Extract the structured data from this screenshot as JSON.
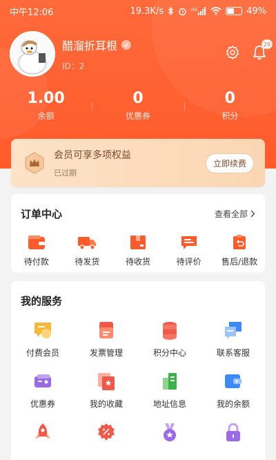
{
  "status_bar": {
    "time": "中午12:06",
    "network_speed": "19.3K/s",
    "battery": "49%",
    "battery_level": 0.49
  },
  "profile": {
    "username": "醋溜折耳根",
    "user_id": "ID：2",
    "notification_count": "29"
  },
  "stats": [
    {
      "value": "1.00",
      "label": "余额"
    },
    {
      "value": "0",
      "label": "优惠券"
    },
    {
      "value": "0",
      "label": "积分"
    }
  ],
  "membership": {
    "title": "会员可享多项权益",
    "status": "已过期",
    "renew_label": "立即续费"
  },
  "orders": {
    "title": "订单中心",
    "see_all": "查看全部",
    "items": [
      {
        "label": "待付款",
        "icon": "wallet-icon"
      },
      {
        "label": "待发货",
        "icon": "truck-icon"
      },
      {
        "label": "待收货",
        "icon": "package-icon"
      },
      {
        "label": "待评价",
        "icon": "comment-icon"
      },
      {
        "label": "售后/退款",
        "icon": "refund-icon"
      }
    ]
  },
  "services": {
    "title": "我的服务",
    "items": [
      {
        "label": "付费会员",
        "icon": "vip-icon"
      },
      {
        "label": "发票管理",
        "icon": "invoice-icon"
      },
      {
        "label": "积分中心",
        "icon": "points-icon"
      },
      {
        "label": "联系客服",
        "icon": "chat-icon"
      },
      {
        "label": "优惠券",
        "icon": "coupon-icon"
      },
      {
        "label": "我的收藏",
        "icon": "favorite-icon"
      },
      {
        "label": "地址信息",
        "icon": "address-icon"
      },
      {
        "label": "我的余额",
        "icon": "balance-icon"
      },
      {
        "label": "",
        "icon": "rocket-icon"
      },
      {
        "label": "",
        "icon": "discount-icon"
      },
      {
        "label": "",
        "icon": "medal-icon"
      },
      {
        "label": "",
        "icon": "lock-icon"
      }
    ]
  },
  "colors": {
    "brand": "#ff5a2a",
    "member_bg": "#fde2c6"
  }
}
